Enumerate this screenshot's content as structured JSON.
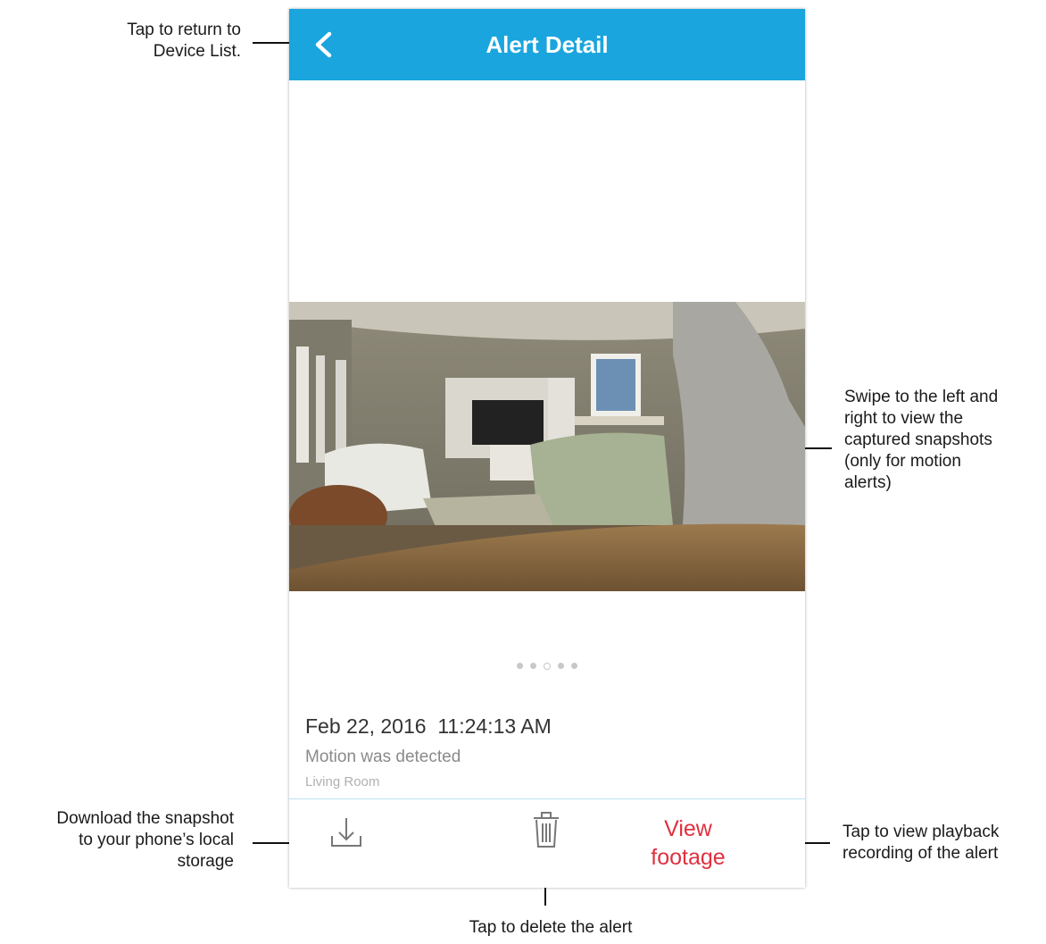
{
  "header": {
    "title": "Alert Detail",
    "back_icon": "chevron-left-icon"
  },
  "snapshot": {
    "dots_total": 5,
    "active_index": 2
  },
  "alert": {
    "datetime": "Feb 22, 2016  11:24:13 AM",
    "type": "Motion was detected",
    "location": "Living Room"
  },
  "actions": {
    "download_icon": "download-icon",
    "delete_icon": "trash-icon",
    "view_footage_line1": "View",
    "view_footage_line2": "footage"
  },
  "callouts": {
    "back": [
      "Tap to return to",
      "Device List."
    ],
    "swipe": [
      "Swipe to the left and",
      "right to view the",
      "captured snapshots",
      "(only for motion",
      "alerts)"
    ],
    "download": [
      "Download the snapshot",
      "to your phone’s local",
      "storage"
    ],
    "playback": [
      "Tap to view playback",
      "recording of the alert"
    ],
    "delete": "Tap to delete the alert"
  },
  "colors": {
    "header": "#1aa5de",
    "accent_red": "#e0303f"
  }
}
